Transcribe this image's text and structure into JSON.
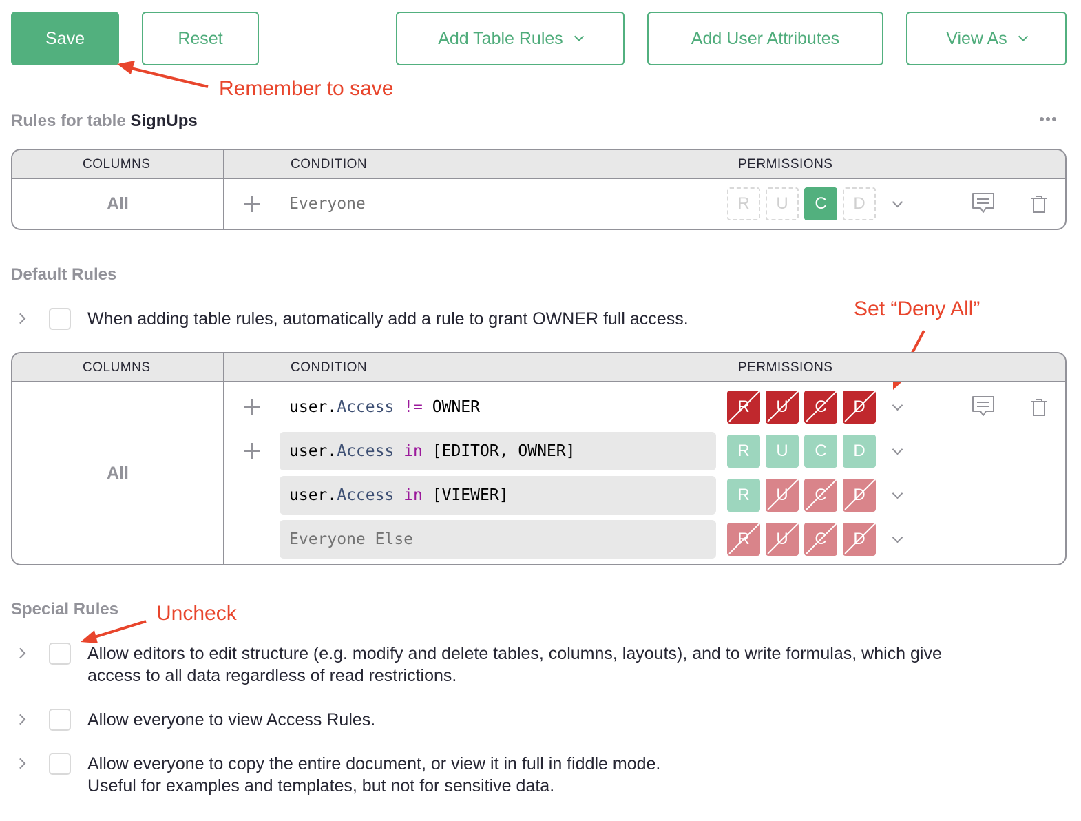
{
  "toolbar": {
    "save_label": "Save",
    "reset_label": "Reset",
    "add_table_rules_label": "Add Table Rules",
    "add_user_attributes_label": "Add User Attributes",
    "view_as_label": "View As"
  },
  "annotations": {
    "remember_to_save": "Remember to save",
    "set_deny_all": "Set “Deny All”",
    "uncheck": "Uncheck",
    "color": "#e8452c"
  },
  "table_rules": {
    "title_prefix": "Rules for table",
    "table_name": "SignUps",
    "more_icon": "more-dots-icon",
    "headers": {
      "columns": "COLUMNS",
      "condition": "CONDITION",
      "permissions": "PERMISSIONS"
    },
    "rows": [
      {
        "columns": "All",
        "condition": "Everyone",
        "permissions": [
          {
            "letter": "R",
            "state": "unset"
          },
          {
            "letter": "U",
            "state": "unset"
          },
          {
            "letter": "C",
            "state": "allow"
          },
          {
            "letter": "D",
            "state": "unset"
          }
        ]
      }
    ]
  },
  "default_rules": {
    "title": "Default Rules",
    "owner_option": {
      "label": "When adding table rules, automatically add a rule to grant OWNER full access.",
      "checked": false
    },
    "headers": {
      "columns": "COLUMNS",
      "condition": "CONDITION",
      "permissions": "PERMISSIONS"
    },
    "columns": "All",
    "rows": [
      {
        "condition_parts": {
          "obj": "user",
          "dot": ".",
          "attr": "Access",
          "op": "!=",
          "value": "OWNER"
        },
        "permissions": [
          {
            "letter": "R",
            "state": "deny"
          },
          {
            "letter": "U",
            "state": "deny"
          },
          {
            "letter": "C",
            "state": "deny"
          },
          {
            "letter": "D",
            "state": "deny"
          }
        ]
      },
      {
        "condition_parts": {
          "obj": "user",
          "dot": ".",
          "attr": "Access",
          "op": "in",
          "value": "[EDITOR, OWNER]"
        },
        "permissions": [
          {
            "letter": "R",
            "state": "allow"
          },
          {
            "letter": "U",
            "state": "allow"
          },
          {
            "letter": "C",
            "state": "allow"
          },
          {
            "letter": "D",
            "state": "allow"
          }
        ]
      },
      {
        "condition_parts": {
          "obj": "user",
          "dot": ".",
          "attr": "Access",
          "op": "in",
          "value": "[VIEWER]"
        },
        "permissions": [
          {
            "letter": "R",
            "state": "allow"
          },
          {
            "letter": "U",
            "state": "deny"
          },
          {
            "letter": "C",
            "state": "deny"
          },
          {
            "letter": "D",
            "state": "deny"
          }
        ]
      },
      {
        "condition": "Everyone Else",
        "permissions": [
          {
            "letter": "R",
            "state": "deny"
          },
          {
            "letter": "U",
            "state": "deny"
          },
          {
            "letter": "C",
            "state": "deny"
          },
          {
            "letter": "D",
            "state": "deny"
          }
        ]
      }
    ]
  },
  "special_rules": {
    "title": "Special Rules",
    "items": [
      {
        "line1": "Allow editors to edit structure (e.g. modify and delete tables, columns, layouts), and to write formulas, which give",
        "line2": "access to all data regardless of read restrictions.",
        "checked": false
      },
      {
        "line1": "Allow everyone to view Access Rules.",
        "line2": "",
        "checked": false
      },
      {
        "line1": "Allow everyone to copy the entire document, or view it in full in fiddle mode.",
        "line2": "Useful for examples and templates, but not for sensitive data.",
        "checked": false
      }
    ]
  },
  "colors": {
    "accent": "#52b07e",
    "allow": "#52b07e",
    "allow_light": "#9dd6be",
    "deny": "#c0282d",
    "deny_light": "#d9848a",
    "muted": "#929299"
  }
}
